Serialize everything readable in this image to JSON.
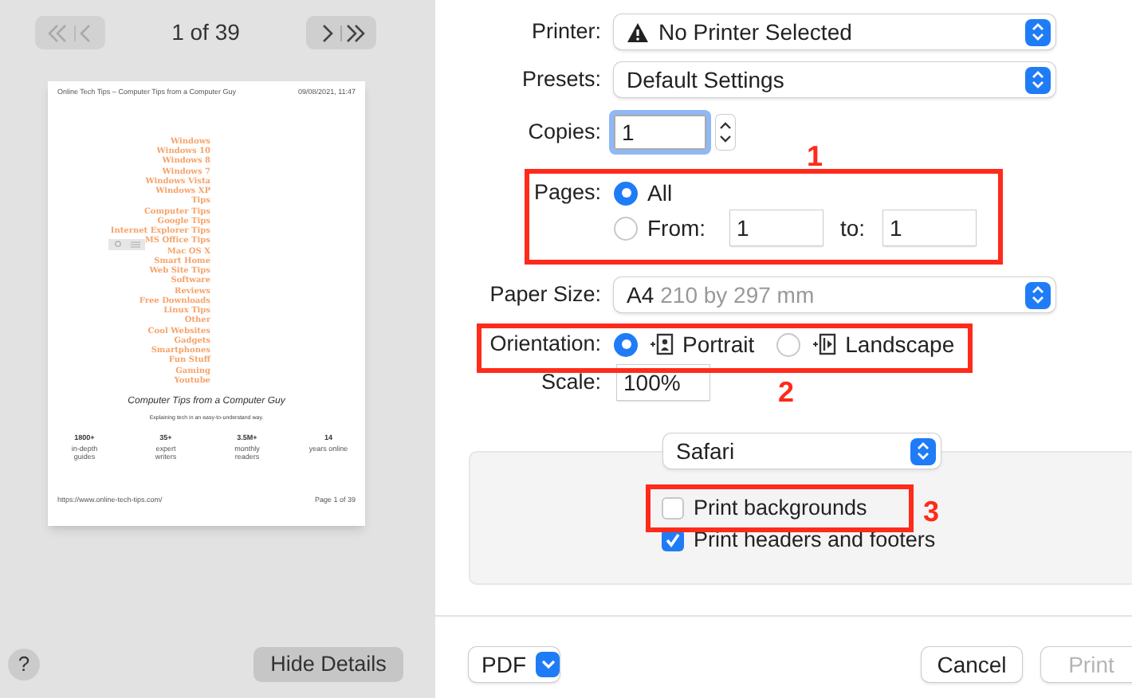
{
  "preview": {
    "page_indicator": "1 of 39",
    "document": {
      "header_left": "Online Tech Tips – Computer Tips from a Computer Guy",
      "header_right": "09/08/2021, 11:47",
      "menu": [
        "Windows",
        "Windows 10",
        "Windows 8",
        "Windows 7",
        "Windows Vista",
        "Windows XP",
        "Tips",
        "Computer Tips",
        "Google Tips",
        "Internet Explorer Tips",
        "MS Office Tips",
        "Mac OS X",
        "Smart Home",
        "Web Site Tips",
        "Software",
        "Reviews",
        "Free Downloads",
        "Linux Tips",
        "Other",
        "Cool Websites",
        "Gadgets",
        "Smartphones",
        "Fun Stuff",
        "Gaming",
        "Youtube"
      ],
      "title": "Computer Tips from a Computer Guy",
      "tagline": "Explaining tech in an easy-to-understand way.",
      "stats": [
        {
          "value": "1800+",
          "label": "in-depth guides"
        },
        {
          "value": "35+",
          "label": "expert writers"
        },
        {
          "value": "3.5M+",
          "label": "monthly readers"
        },
        {
          "value": "14",
          "label": "years online"
        }
      ],
      "footer_left": "https://www.online-tech-tips.com/",
      "footer_right": "Page 1 of 39"
    },
    "help": "?",
    "hide_details": "Hide Details"
  },
  "form": {
    "printer": {
      "label": "Printer:",
      "value": "No Printer Selected"
    },
    "presets": {
      "label": "Presets:",
      "value": "Default Settings"
    },
    "copies": {
      "label": "Copies:",
      "value": "1"
    },
    "pages": {
      "label": "Pages:",
      "options": [
        {
          "label": "All",
          "selected": true
        },
        {
          "label": "From:",
          "selected": false
        }
      ],
      "from_value": "1",
      "to_label": "to:",
      "to_value": "1"
    },
    "paper_size": {
      "label": "Paper Size:",
      "value": "A4",
      "detail": "210 by 297 mm"
    },
    "orientation": {
      "label": "Orientation:",
      "options": [
        {
          "label": "Portrait",
          "selected": true
        },
        {
          "label": "Landscape",
          "selected": false
        }
      ]
    },
    "scale": {
      "label": "Scale:",
      "value": "100%"
    },
    "app_menu": "Safari",
    "checkboxes": [
      {
        "label": "Print backgrounds",
        "checked": false
      },
      {
        "label": "Print headers and footers",
        "checked": true
      }
    ]
  },
  "footer": {
    "pdf": "PDF",
    "buttons": [
      {
        "label": "Cancel",
        "disabled": false
      },
      {
        "label": "Print",
        "disabled": true
      }
    ]
  },
  "annotations": [
    {
      "number": "1"
    },
    {
      "number": "2"
    },
    {
      "number": "3"
    }
  ]
}
